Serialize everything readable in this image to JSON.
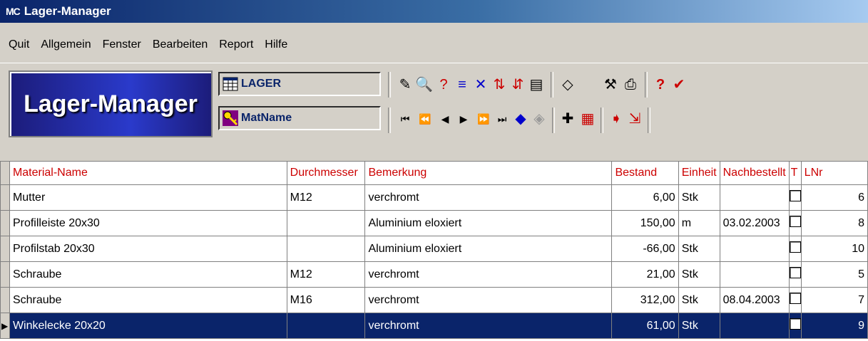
{
  "window": {
    "app_icon": "MC",
    "title": "Lager-Manager"
  },
  "menu": [
    "Quit",
    "Allgemein",
    "Fenster",
    "Bearbeiten",
    "Report",
    "Hilfe"
  ],
  "toolbar": {
    "logo_text": "Lager-Manager",
    "table_field": "LAGER",
    "index_field": "MatName"
  },
  "grid": {
    "columns": [
      "Material-Name",
      "Durchmesser",
      "Bemerkung",
      "Bestand",
      "Einheit",
      "Nachbestellt",
      "T",
      "LNr"
    ],
    "rows": [
      {
        "name": "Mutter",
        "durchmesser": "M12",
        "bemerkung": "verchromt",
        "bestand": "6,00",
        "einheit": "Stk",
        "nachbestellt": "",
        "lnr": "6"
      },
      {
        "name": "Profilleiste 20x30",
        "durchmesser": "",
        "bemerkung": "Aluminium eloxiert",
        "bestand": "150,00",
        "einheit": "m",
        "nachbestellt": "03.02.2003",
        "lnr": "8"
      },
      {
        "name": "Profilstab 20x30",
        "durchmesser": "",
        "bemerkung": "Aluminium eloxiert",
        "bestand": "-66,00",
        "einheit": "Stk",
        "nachbestellt": "",
        "lnr": "10"
      },
      {
        "name": "Schraube",
        "durchmesser": "M12",
        "bemerkung": "verchromt",
        "bestand": "21,00",
        "einheit": "Stk",
        "nachbestellt": "",
        "lnr": "5"
      },
      {
        "name": "Schraube",
        "durchmesser": "M16",
        "bemerkung": "verchromt",
        "bestand": "312,00",
        "einheit": "Stk",
        "nachbestellt": "08.04.2003",
        "lnr": "7"
      },
      {
        "name": "Winkelecke 20x20",
        "durchmesser": "",
        "bemerkung": "verchromt",
        "bestand": "61,00",
        "einheit": "Stk",
        "nachbestellt": "",
        "lnr": "9"
      }
    ]
  },
  "colors": {
    "title_start": "#0a246a",
    "header_text": "#cc0000",
    "selected_row": "#0a246a"
  }
}
